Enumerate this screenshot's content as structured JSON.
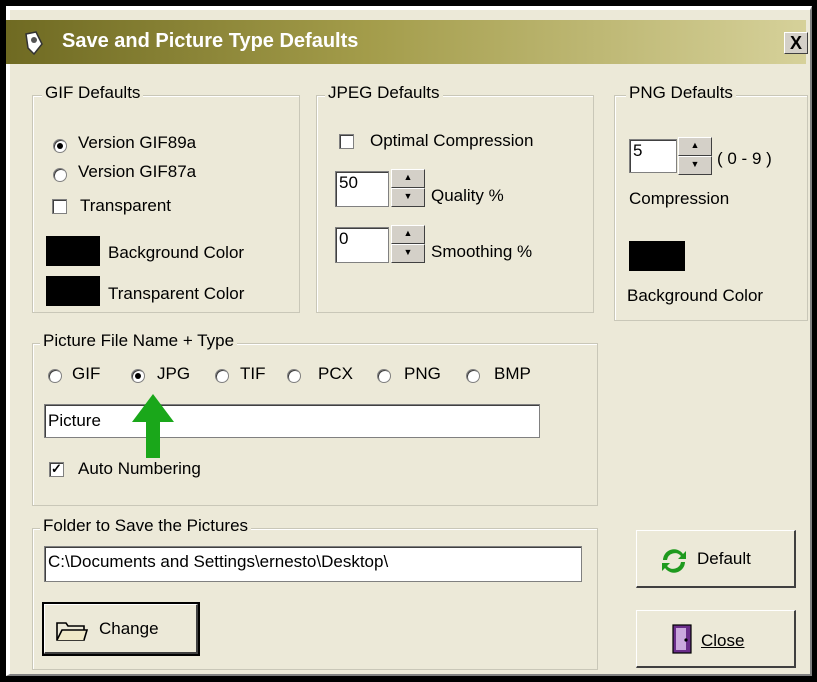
{
  "window": {
    "title": "Save and Picture Type Defaults",
    "close_label": "X"
  },
  "gif": {
    "group_title": "GIF Defaults",
    "version_89a": "Version GIF89a",
    "version_87a": "Version GIF87a",
    "transparent": "Transparent",
    "background_color": "Background Color",
    "transparent_color": "Transparent Color"
  },
  "jpeg": {
    "group_title": "JPEG Defaults",
    "optimal": "Optimal Compression",
    "quality_value": "50",
    "quality_label": "Quality %",
    "smoothing_value": "0",
    "smoothing_label": "Smoothing %"
  },
  "png": {
    "group_title": "PNG Defaults",
    "compression_value": "5",
    "range": "( 0 - 9 )",
    "compression_label": "Compression",
    "background_color": "Background Color"
  },
  "picture": {
    "group_title": "Picture File Name + Type",
    "types": [
      "GIF",
      "JPG",
      "TIF",
      "PCX",
      "PNG",
      "BMP"
    ],
    "selected": "JPG",
    "file_name": "Picture",
    "auto_numbering": "Auto Numbering"
  },
  "folder": {
    "group_title": "Folder to Save the Pictures",
    "path": "C:\\Documents and Settings\\ernesto\\Desktop\\",
    "change_label": "Change"
  },
  "buttons": {
    "default_label": "Default",
    "close_label": "Close"
  },
  "colors": {
    "title_gradient_start": "#6f6a22",
    "title_gradient_end": "#d6d19a",
    "arrow": "#1aa71a",
    "swatch": "#000000"
  }
}
